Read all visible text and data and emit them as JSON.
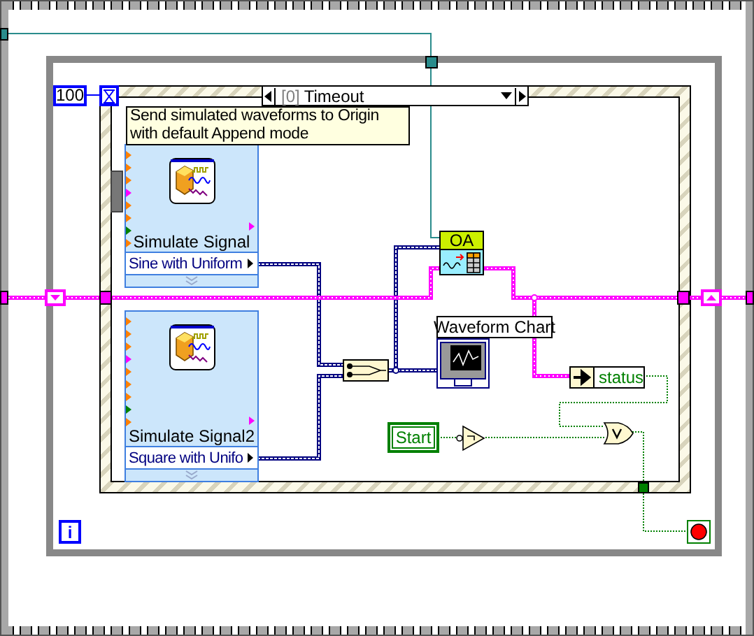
{
  "event_structure": {
    "timeout_constant": "100",
    "case_selector": {
      "index": "[0]",
      "label": "Timeout"
    },
    "comment": "Send simulated waveforms to Origin with default Append mode"
  },
  "express_vis": [
    {
      "kind": "simulate_signal",
      "title": "Simulate Signal",
      "setting": "Sine with Uniform"
    },
    {
      "kind": "simulate_signal",
      "title": "Simulate Signal2",
      "setting": "Square with Unifo"
    }
  ],
  "origin_node": {
    "label": "OA"
  },
  "waveform_chart": {
    "label": "Waveform Chart"
  },
  "status_indicator": {
    "label": "status"
  },
  "start_control": {
    "label": "Start"
  },
  "while_loop": {
    "iteration_terminal": "i"
  }
}
